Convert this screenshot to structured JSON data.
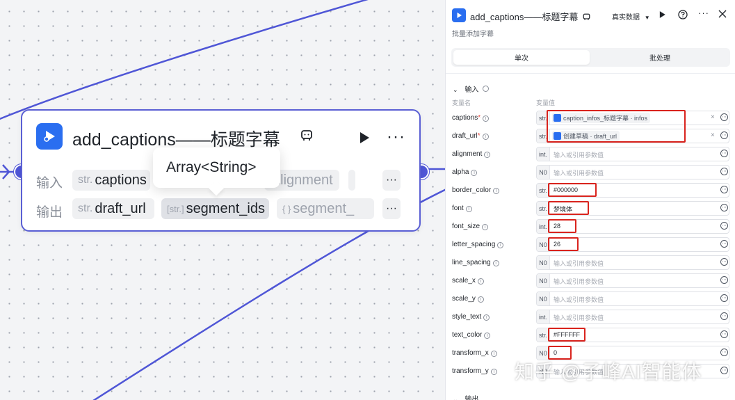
{
  "node": {
    "title": "add_captions——标题字幕",
    "input_label": "输入",
    "output_label": "输出",
    "inputs": [
      {
        "type": "str.",
        "name": "captions"
      },
      {
        "type": "",
        "name": "alignment"
      }
    ],
    "outputs": [
      {
        "type": "str.",
        "name": "draft_url"
      },
      {
        "type": "[str.]",
        "name": "segment_ids"
      },
      {
        "type": "{ }",
        "name": "segment_"
      }
    ],
    "more_label": "···",
    "tooltip": "Array<String>"
  },
  "panel": {
    "title": "add_captions——标题字幕",
    "subtitle": "批量添加字幕",
    "data_mode": "真实数据",
    "tabs": [
      "单次",
      "批处理"
    ],
    "input_section": "输入",
    "output_section": "输出",
    "col_name": "变量名",
    "col_value": "变量值",
    "placeholder": "输入或引用参数值",
    "params": [
      {
        "name": "captions",
        "required": true,
        "type": "str.",
        "ref": "caption_infos_标题字幕 · infos",
        "value": ""
      },
      {
        "name": "draft_url",
        "required": true,
        "type": "str.",
        "ref": "创建草稿 · draft_url",
        "value": ""
      },
      {
        "name": "alignment",
        "required": false,
        "type": "int.",
        "ref": "",
        "value": ""
      },
      {
        "name": "alpha",
        "required": false,
        "type": "N0",
        "ref": "",
        "value": ""
      },
      {
        "name": "border_color",
        "required": false,
        "type": "str.",
        "ref": "",
        "value": "#000000"
      },
      {
        "name": "font",
        "required": false,
        "type": "str.",
        "ref": "",
        "value": "梦境体"
      },
      {
        "name": "font_size",
        "required": false,
        "type": "int.",
        "ref": "",
        "value": "28"
      },
      {
        "name": "letter_spacing",
        "required": false,
        "type": "N0",
        "ref": "",
        "value": "26"
      },
      {
        "name": "line_spacing",
        "required": false,
        "type": "N0",
        "ref": "",
        "value": ""
      },
      {
        "name": "scale_x",
        "required": false,
        "type": "N0",
        "ref": "",
        "value": ""
      },
      {
        "name": "scale_y",
        "required": false,
        "type": "N0",
        "ref": "",
        "value": ""
      },
      {
        "name": "style_text",
        "required": false,
        "type": "int.",
        "ref": "",
        "value": ""
      },
      {
        "name": "text_color",
        "required": false,
        "type": "str.",
        "ref": "",
        "value": "#FFFFFF"
      },
      {
        "name": "transform_x",
        "required": false,
        "type": "N0",
        "ref": "",
        "value": "0"
      },
      {
        "name": "transform_y",
        "required": false,
        "type": "N0",
        "ref": "",
        "value": ""
      }
    ]
  },
  "watermark": "知乎 @子峰AI智能体",
  "colors": {
    "accent": "#4f56d6",
    "brand": "#2a6ef0",
    "highlight": "#d9231d"
  }
}
